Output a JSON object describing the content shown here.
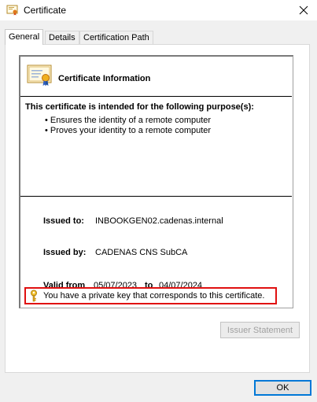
{
  "window": {
    "title": "Certificate"
  },
  "tabs": [
    {
      "label": "General"
    },
    {
      "label": "Details"
    },
    {
      "label": "Certification Path"
    }
  ],
  "info": {
    "title": "Certificate Information",
    "purpose_heading": "This certificate is intended for the following purpose(s):",
    "purposes": [
      "Ensures the identity of a remote computer",
      "Proves your identity to a remote computer"
    ],
    "issued_to_label": "Issued to:",
    "issued_to_value": "INBOOKGEN02.cadenas.internal",
    "issued_by_label": "Issued by:",
    "issued_by_value": "CADENAS CNS SubCA",
    "valid_from_label": "Valid from",
    "valid_from_value": "05/07/2023",
    "valid_to_label": "to",
    "valid_to_value": "04/07/2024",
    "private_key_notice": "You have a private key that corresponds to this certificate."
  },
  "buttons": {
    "issuer_statement": "Issuer Statement",
    "ok": "OK"
  },
  "icons": {
    "title": "certificate-icon",
    "close": "close-icon",
    "info": "certificate-ribbon-icon",
    "key": "key-icon"
  },
  "colors": {
    "highlight_border": "#e01010",
    "focus_border": "#0078d7"
  }
}
